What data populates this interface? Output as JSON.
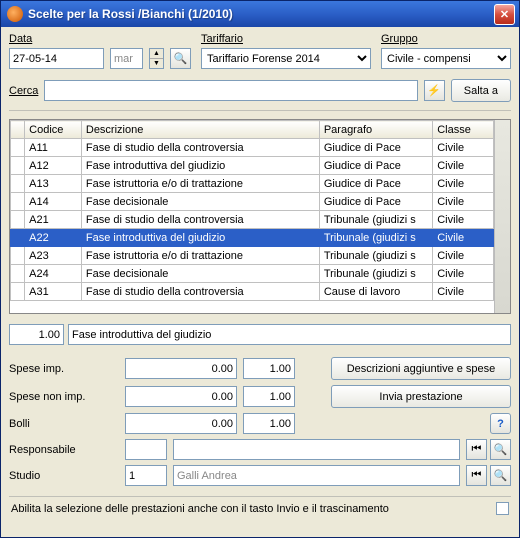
{
  "window": {
    "title": "Scelte per la Rossi /Bianchi (1/2010)"
  },
  "header": {
    "data_label": "Data",
    "data_value": "27-05-14",
    "day_value": "mar",
    "tariffario_label": "Tariffario",
    "tariffario_value": "Tariffario Forense 2014",
    "gruppo_label": "Gruppo",
    "gruppo_value": "Civile - compensi"
  },
  "search": {
    "label": "Cerca",
    "value": "",
    "salta_label": "Salta a"
  },
  "grid": {
    "headers": {
      "codice": "Codice",
      "descrizione": "Descrizione",
      "paragrafo": "Paragrafo",
      "classe": "Classe"
    },
    "rows": [
      {
        "codice": "A11",
        "descrizione": "Fase di studio della controversia",
        "paragrafo": "Giudice di Pace",
        "classe": "Civile"
      },
      {
        "codice": "A12",
        "descrizione": "Fase introduttiva del giudizio",
        "paragrafo": "Giudice di Pace",
        "classe": "Civile"
      },
      {
        "codice": "A13",
        "descrizione": "Fase istruttoria e/o di trattazione",
        "paragrafo": "Giudice di Pace",
        "classe": "Civile"
      },
      {
        "codice": "A14",
        "descrizione": "Fase decisionale",
        "paragrafo": "Giudice di Pace",
        "classe": "Civile"
      },
      {
        "codice": "A21",
        "descrizione": "Fase di studio della controversia",
        "paragrafo": "Tribunale (giudizi s",
        "classe": "Civile"
      },
      {
        "codice": "A22",
        "descrizione": "Fase introduttiva del giudizio",
        "paragrafo": "Tribunale (giudizi s",
        "classe": "Civile",
        "selected": true
      },
      {
        "codice": "A23",
        "descrizione": "Fase istruttoria e/o di trattazione",
        "paragrafo": "Tribunale (giudizi s",
        "classe": "Civile"
      },
      {
        "codice": "A24",
        "descrizione": "Fase decisionale",
        "paragrafo": "Tribunale (giudizi s",
        "classe": "Civile"
      },
      {
        "codice": "A31",
        "descrizione": "Fase di studio della controversia",
        "paragrafo": "Cause di lavoro",
        "classe": "Civile"
      }
    ]
  },
  "selected_summary": {
    "qty": "1.00",
    "desc": "Fase introduttiva del giudizio"
  },
  "fields": {
    "spese_imp_label": "Spese imp.",
    "spese_imp_val": "0.00",
    "spese_imp_mul": "1.00",
    "spese_non_imp_label": "Spese non imp.",
    "spese_non_imp_val": "0.00",
    "spese_non_imp_mul": "1.00",
    "bolli_label": "Bolli",
    "bolli_val": "0.00",
    "bolli_mul": "1.00",
    "responsabile_label": "Responsabile",
    "responsabile_code": "",
    "responsabile_name": "",
    "studio_label": "Studio",
    "studio_code": "1",
    "studio_name": "Galli Andrea"
  },
  "buttons": {
    "descrizioni": "Descrizioni aggiuntive e spese",
    "invia": "Invia prestazione"
  },
  "footer": {
    "checkbox_label": "Abilita la selezione delle prestazioni anche con il tasto Invio e il trascinamento"
  }
}
